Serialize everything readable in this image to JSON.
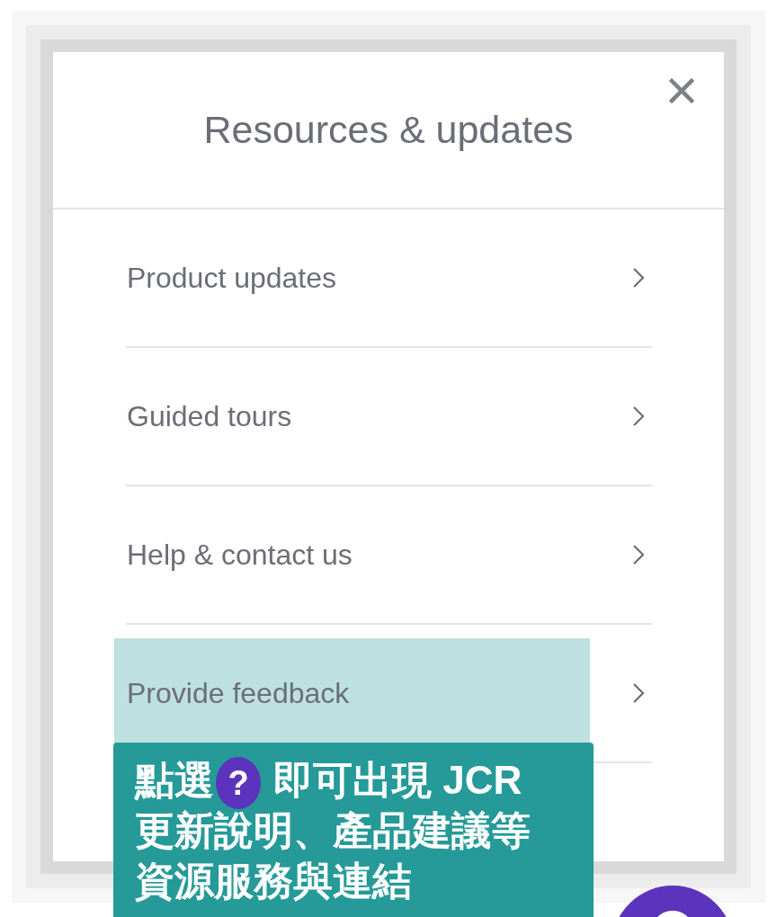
{
  "dialog": {
    "title": "Resources & updates",
    "items": [
      {
        "label": "Product updates",
        "highlighted": false
      },
      {
        "label": "Guided tours",
        "highlighted": false
      },
      {
        "label": "Help & contact us",
        "highlighted": false
      },
      {
        "label": "Provide feedback",
        "highlighted": true
      }
    ]
  },
  "annotation": {
    "text_before": "點選",
    "badge": "?",
    "text_after": "即可出現 JCR",
    "lines": [
      "更新說明、產品建議等",
      "資源服務與連結"
    ]
  }
}
